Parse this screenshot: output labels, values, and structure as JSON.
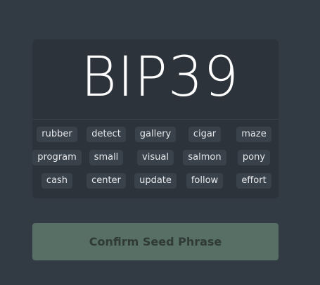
{
  "title": "BIP39",
  "words": [
    "rubber",
    "detect",
    "gallery",
    "cigar",
    "maze",
    "program",
    "small",
    "visual",
    "salmon",
    "pony",
    "cash",
    "center",
    "update",
    "follow",
    "effort"
  ],
  "confirm_label": "Confirm Seed Phrase",
  "colors": {
    "background": "#323a43",
    "card": "#2c333b",
    "chip": "#39414a",
    "button": "#576f64"
  }
}
